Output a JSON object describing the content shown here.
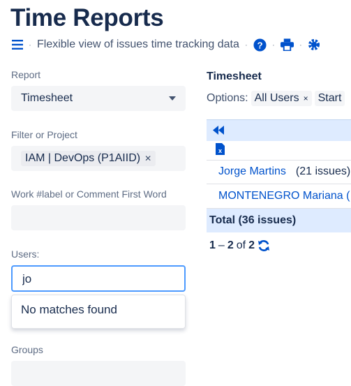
{
  "header": {
    "title": "Time Reports",
    "subtitle": "Flexible view of issues time tracking data",
    "separator": "·",
    "icons": [
      "menu-icon",
      "help-icon",
      "print-icon",
      "settings-icon"
    ]
  },
  "sidebar": {
    "report": {
      "label": "Report",
      "value": "Timesheet"
    },
    "filter": {
      "label": "Filter or Project",
      "tag": "IAM | DevOps (P1AIID)",
      "tag_remove": "✕"
    },
    "work_label": {
      "label": "Work #label or Comment First Word",
      "value": ""
    },
    "users": {
      "label": "Users:",
      "value": "jo",
      "dropdown_message": "No matches found"
    },
    "groups": {
      "label": "Groups"
    }
  },
  "main": {
    "heading": "Timesheet",
    "options_label": "Options:",
    "option_chip": "All Users",
    "option_chip_remove": "×",
    "option_next": "Start",
    "rows": [
      {
        "name": "Jorge Martins",
        "count": "(21 issues)"
      },
      {
        "name": "MONTENEGRO Mariana (",
        "count": ""
      }
    ],
    "total": "Total (36 issues)",
    "pager": {
      "start": "1",
      "dash": "–",
      "end": "2",
      "of": "of",
      "total": "2"
    }
  },
  "colors": {
    "accent": "#0052cc",
    "table_header": "#deebff",
    "focus_border": "#4c9aff",
    "xls_green": "#0052cc"
  }
}
